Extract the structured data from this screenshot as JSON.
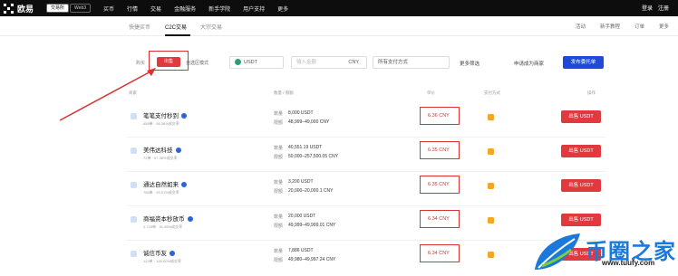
{
  "nav": {
    "logo": "欧易",
    "chips": [
      "交易所",
      "Web3"
    ],
    "links": [
      "买币",
      "行情",
      "交易",
      "金融服务",
      "新手学院",
      "用户支持",
      "更多"
    ],
    "login": "登录",
    "register": "注册"
  },
  "subnav": {
    "tabs": [
      "快捷买币",
      "C2C交易",
      "大宗交易"
    ],
    "right_links": [
      "活动",
      "新手教程",
      "订单",
      "更多"
    ]
  },
  "filter": {
    "buy_label": "购买",
    "sell_label": "出售",
    "mode_label": "自选区模式",
    "coin": "USDT",
    "amount_placeholder": "输入金额",
    "currency": "CNY",
    "payment": "所有支付方式",
    "more_filter": "更多筛选",
    "apply_merchant": "申请成为商家",
    "post_ad": "发布委托单"
  },
  "table": {
    "headers": [
      "商家",
      "数量 / 限额",
      "单价",
      "支付方式",
      "操作"
    ],
    "qty_label": "数量",
    "limit_label": "限额",
    "action_label": "出售 USDT",
    "rows": [
      {
        "name": "笔笔支付秒到",
        "stats": "658单 · 98.38%成交率",
        "qty": "8,000 USDT",
        "limit": "48,999–49,000 CNY",
        "price": "6.36 CNY"
      },
      {
        "name": "美伟达科技",
        "stats": "72单 · 97.38%成交率",
        "qty": "40,551.19 USDT",
        "limit": "50,000–257,500.05 CNY",
        "price": "6.35 CNY"
      },
      {
        "name": "通达自然如来",
        "stats": "765单 · 93.91%成交率",
        "qty": "3,200 USDT",
        "limit": "20,000–20,000.1 CNY",
        "price": "6.35 CNY"
      },
      {
        "name": "商福资本秒放币",
        "stats": "2,728单 · 91.96%成交率",
        "qty": "20,000 USDT",
        "limit": "49,999–49,999.01 CNY",
        "price": "6.34 CNY"
      },
      {
        "name": "诚信币友",
        "stats": "123单 · 100.00%成交率",
        "qty": "7,886 USDT",
        "limit": "49,980–49,997.24 CNY",
        "price": "6.34 CNY"
      }
    ]
  },
  "watermark": {
    "brand": "币圈之家",
    "url": "www.tuufy.com"
  },
  "colors": {
    "sell_red": "#e0393e",
    "highlight_red": "#d83434",
    "post_blue": "#1d4bd8",
    "nav_black": "#0d0d0d"
  }
}
